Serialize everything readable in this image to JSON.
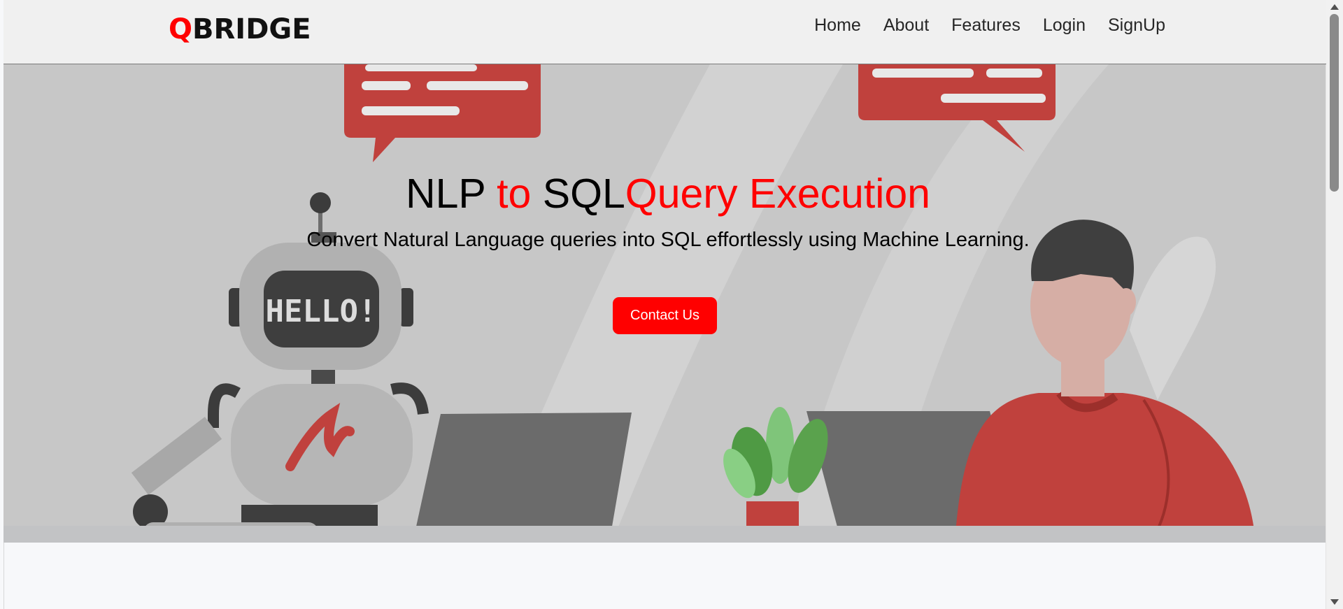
{
  "brand": {
    "first_letter": "Q",
    "rest": "BRIDGE"
  },
  "nav": {
    "items": [
      {
        "label": "Home"
      },
      {
        "label": "About"
      },
      {
        "label": "Features"
      },
      {
        "label": "Login"
      },
      {
        "label": "SignUp"
      }
    ]
  },
  "hero": {
    "title_part1": "NLP ",
    "title_part2": "to",
    "title_part3": " SQL",
    "title_part4": "Query Execution",
    "subtitle": "Convert Natural Language queries into SQL effortlessly using Machine Learning.",
    "cta_label": "Contact Us",
    "robot_screen_text": "HELLO!"
  },
  "colors": {
    "accent": "#ff0000",
    "navbar_bg": "#f0f0f0",
    "hero_bg": "#c7c7c7",
    "illustration_red": "#c0413d"
  }
}
